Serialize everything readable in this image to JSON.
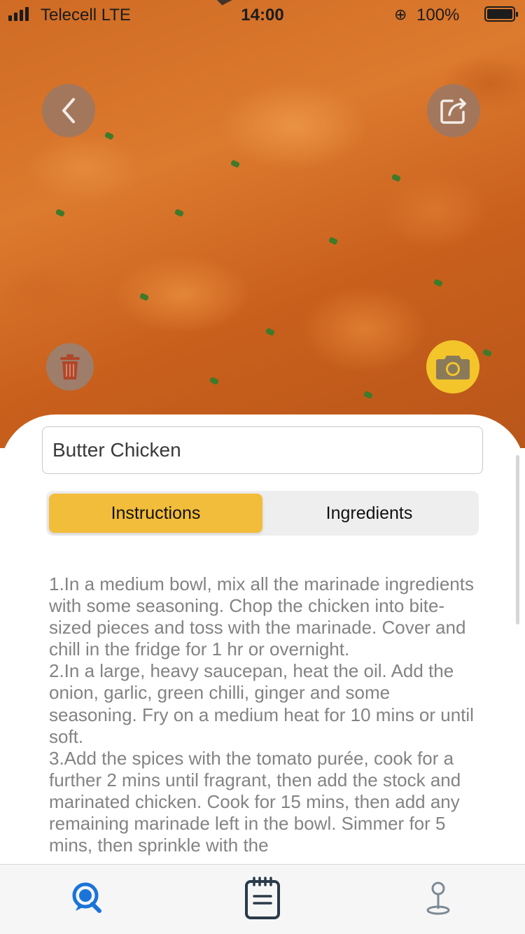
{
  "status_bar": {
    "carrier": "Telecell  LTE",
    "time": "14:00",
    "battery_percent": "100"
  },
  "recipe": {
    "title": "Butter Chicken"
  },
  "tabs": [
    {
      "label": "Instructions",
      "active": true
    },
    {
      "label": "Ingredients",
      "active": false
    }
  ],
  "instructions": [
    "1.In a medium bowl, mix all the marinade ingredients with some seasoning. Chop the chicken into bite-sized pieces and toss with the marinade. Cover and chill in the fridge for 1 hr or overnight.",
    "2.In a large, heavy saucepan, heat the oil. Add the onion, garlic, green chilli, ginger and some seasoning. Fry on a medium heat for 10 mins or until soft.",
    "3.Add the spices with the tomato purée, cook for a further 2 mins until fragrant, then add the stock and marinated chicken. Cook for 15 mins, then add any remaining marinade left in the bowl. Simmer for 5 mins, then sprinkle with the"
  ],
  "icons": {
    "back": "chevron-left-icon",
    "share": "share-icon",
    "delete": "trash-icon",
    "camera": "camera-icon",
    "tab_search": "search-bubble-icon",
    "tab_notes": "notepad-icon",
    "tab_map": "location-pin-icon"
  },
  "colors": {
    "accent_yellow": "#f2bd3a",
    "camera_yellow": "#f3c52a",
    "active_tab_blue": "#1a73d9",
    "text_gray": "#838383"
  }
}
